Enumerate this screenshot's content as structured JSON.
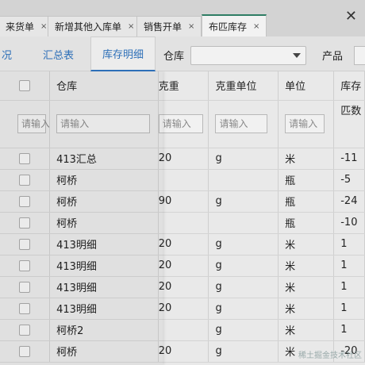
{
  "tabs": [
    {
      "label": "来货单",
      "active": false
    },
    {
      "label": "新增其他入库单",
      "active": false
    },
    {
      "label": "销售开单",
      "active": false
    },
    {
      "label": "布匹库存",
      "active": true
    }
  ],
  "tab_close_glyph": "×",
  "window_close_glyph": "✕",
  "subtabs": {
    "partial": "况",
    "summary": "汇总表",
    "detail": "库存明细"
  },
  "filters": {
    "warehouse_label": "仓库",
    "product_label": "产品"
  },
  "table": {
    "headers": {
      "warehouse": "仓库",
      "weight": "克重",
      "weight_unit": "克重单位",
      "unit": "单位",
      "stock": "库存",
      "stock_sub": "匹数"
    },
    "placeholder": "请输入",
    "rows": [
      {
        "warehouse": "413汇总",
        "weight": "20",
        "weight_unit": "g",
        "unit": "米",
        "stock": "-11"
      },
      {
        "warehouse": "柯桥",
        "weight": "",
        "weight_unit": "",
        "unit": "瓶",
        "stock": "-5"
      },
      {
        "warehouse": "柯桥",
        "weight": "90",
        "weight_unit": "g",
        "unit": "瓶",
        "stock": "-24"
      },
      {
        "warehouse": "柯桥",
        "weight": "",
        "weight_unit": "",
        "unit": "瓶",
        "stock": "-10"
      },
      {
        "warehouse": "413明细",
        "weight": "20",
        "weight_unit": "g",
        "unit": "米",
        "stock": "1"
      },
      {
        "warehouse": "413明细",
        "weight": "20",
        "weight_unit": "g",
        "unit": "米",
        "stock": "1"
      },
      {
        "warehouse": "413明细",
        "weight": "20",
        "weight_unit": "g",
        "unit": "米",
        "stock": "1"
      },
      {
        "warehouse": "413明细",
        "weight": "20",
        "weight_unit": "g",
        "unit": "米",
        "stock": "1"
      },
      {
        "warehouse": "柯桥2",
        "weight": "",
        "weight_unit": "g",
        "unit": "米",
        "stock": "1"
      },
      {
        "warehouse": "柯桥",
        "weight": "20",
        "weight_unit": "g",
        "unit": "米",
        "stock": "-20"
      }
    ]
  },
  "watermark": "稀土掘金技术社区"
}
